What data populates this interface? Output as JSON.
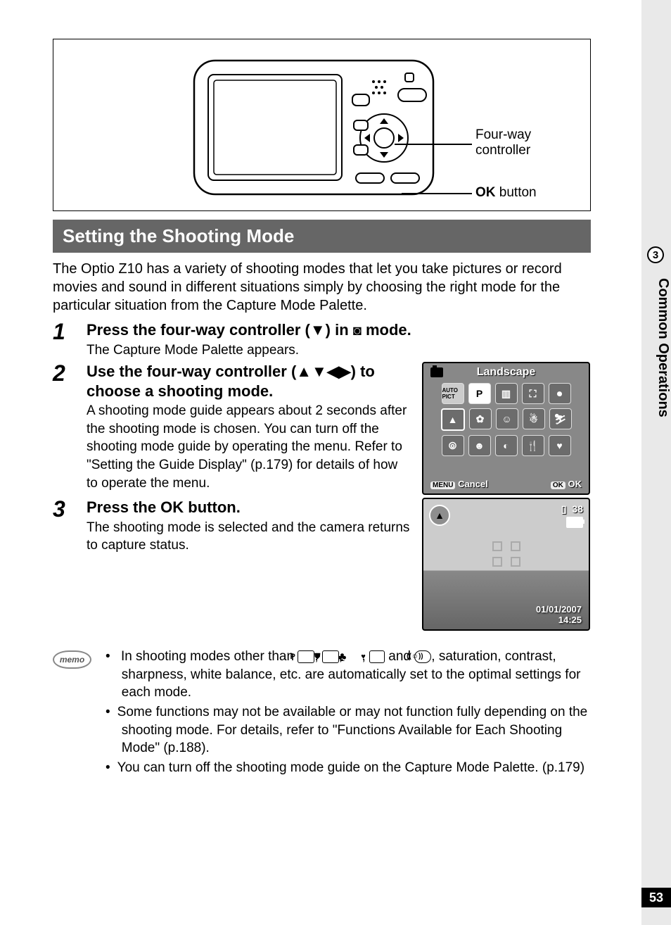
{
  "side": {
    "chapter_number": "3",
    "chapter_title": "Common Operations",
    "page_number": "53"
  },
  "diagram": {
    "callout1_line1": "Four-way",
    "callout1_line2": "controller",
    "callout2_prefix_bold": "OK",
    "callout2_suffix": " button"
  },
  "section_header": "Setting the Shooting Mode",
  "intro": "The Optio Z10 has a variety of shooting modes that let you take pictures or record movies and sound in different situations simply by choosing the right mode for the particular situation from the Capture Mode Palette.",
  "steps": {
    "s1": {
      "num": "1",
      "title_pre": "Press the four-way controller (",
      "title_arrow": "▼",
      "title_mid": ") in ",
      "title_post": " mode.",
      "desc": "The Capture Mode Palette appears."
    },
    "s2": {
      "num": "2",
      "title_pre": "Use the four-way controller (",
      "title_arrows": "▲▼◀▶",
      "title_post": ") to choose a shooting mode.",
      "desc": "A shooting mode guide appears about 2 seconds after the shooting mode is chosen. You can turn off the shooting mode guide by operating the menu. Refer to \"Setting the Guide Display\" (p.179) for details of how to operate the menu."
    },
    "s3": {
      "num": "3",
      "title_pre": "Press the ",
      "title_ok": "OK",
      "title_post": " button.",
      "desc": "The shooting mode is selected and the camera returns to capture status."
    }
  },
  "lcd_palette": {
    "title": "Landscape",
    "icons": {
      "auto": "AUTO PICT",
      "p": "P",
      "night": "▥",
      "nightperson": "⛶",
      "mic": "⏺",
      "landscape": "▲",
      "flower": "✿",
      "face": "☺",
      "snow": "☃",
      "ski": "⛷",
      "people": "⦾",
      "kids": "☻",
      "pet": "◐",
      "food": "🍴",
      "heart": "♥"
    },
    "menu_badge": "MENU",
    "cancel": "Cancel",
    "ok_badge": "OK",
    "ok": "OK"
  },
  "lcd_capture": {
    "mode_icon": "▲",
    "card_icon": "▯",
    "remaining": "38",
    "date": "01/01/2007",
    "time": "14:25"
  },
  "memo": {
    "label": "memo",
    "item1_pre": "In shooting modes other than ",
    "item1_p": "P",
    "item1_sep": ", ",
    "item1_and": " and ",
    "item1_post": ", saturation, contrast, sharpness, white balance, etc. are automatically set to the optimal settings for each mode.",
    "item2": "Some functions may not be available or may not function fully depending on the shooting mode. For details, refer to \"Functions Available for Each Shooting Mode\" (p.188).",
    "item3": "You can turn off the shooting mode guide on the Capture Mode Palette. (p.179)"
  }
}
